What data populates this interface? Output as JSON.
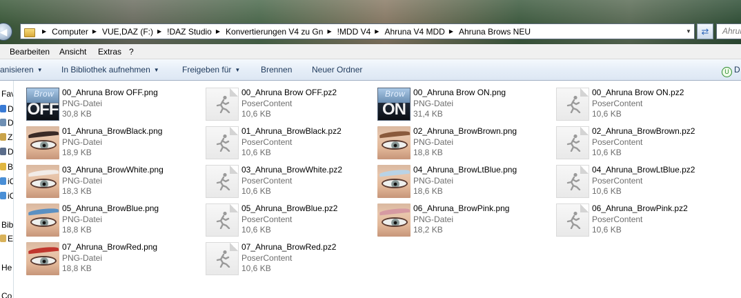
{
  "address_bar": {
    "crumbs": [
      "Computer",
      "VUE,DAZ (F:)",
      "!DAZ Studio",
      "Konvertierungen V4 zu Gn",
      "!MDD V4",
      "Ahruna V4 MDD",
      "Ahruna Brows NEU"
    ],
    "search_placeholder": "Ahrun"
  },
  "menu": [
    "Bearbeiten",
    "Ansicht",
    "Extras",
    "?"
  ],
  "commands": {
    "organize": "anisieren",
    "library": "In Bibliothek aufnehmen",
    "share": "Freigeben für",
    "burn": "Brennen",
    "new_folder": "Neuer Ordner",
    "view_label": "D"
  },
  "nav": {
    "favorites": "Fav",
    "items": [
      "D",
      "D",
      "Z",
      "D",
      "B",
      "iC",
      "iC"
    ],
    "libraries": "Bib",
    "lib_item": "E",
    "homegroup": "He",
    "computer": "Co"
  },
  "files": [
    {
      "name": "00_Ahruna Brow OFF.png",
      "type": "PNG-Datei",
      "size": "30,8 KB",
      "thumb": "off"
    },
    {
      "name": "00_Ahruna Brow OFF.pz2",
      "type": "PoserContent",
      "size": "10,6 KB",
      "thumb": "poser"
    },
    {
      "name": "00_Ahruna Brow ON.png",
      "type": "PNG-Datei",
      "size": "31,4 KB",
      "thumb": "on"
    },
    {
      "name": "00_Ahruna Brow ON.pz2",
      "type": "PoserContent",
      "size": "10,6 KB",
      "thumb": "poser"
    },
    {
      "name": "01_Ahruna_BrowBlack.png",
      "type": "PNG-Datei",
      "size": "18,9 KB",
      "thumb": "eye",
      "brow_color": "#3a2a26"
    },
    {
      "name": "01_Ahruna_BrowBlack.pz2",
      "type": "PoserContent",
      "size": "10,6 KB",
      "thumb": "poser"
    },
    {
      "name": "02_Ahruna_BrowBrown.png",
      "type": "PNG-Datei",
      "size": "18,8 KB",
      "thumb": "eye",
      "brow_color": "#8a5a3c"
    },
    {
      "name": "02_Ahruna_BrowBrown.pz2",
      "type": "PoserContent",
      "size": "10,6 KB",
      "thumb": "poser"
    },
    {
      "name": "03_Ahruna_BrowWhite.png",
      "type": "PNG-Datei",
      "size": "18,3 KB",
      "thumb": "eye",
      "brow_color": "#f2ece8"
    },
    {
      "name": "03_Ahruna_BrowWhite.pz2",
      "type": "PoserContent",
      "size": "10,6 KB",
      "thumb": "poser"
    },
    {
      "name": "04_Ahruna_BrowLtBlue.png",
      "type": "PNG-Datei",
      "size": "18,6 KB",
      "thumb": "eye",
      "brow_color": "#b9d3e6"
    },
    {
      "name": "04_Ahruna_BrowLtBlue.pz2",
      "type": "PoserContent",
      "size": "10,6 KB",
      "thumb": "poser"
    },
    {
      "name": "05_Ahruna_BrowBlue.png",
      "type": "PNG-Datei",
      "size": "18,8 KB",
      "thumb": "eye",
      "brow_color": "#5b90c2"
    },
    {
      "name": "05_Ahruna_BrowBlue.pz2",
      "type": "PoserContent",
      "size": "10,6 KB",
      "thumb": "poser"
    },
    {
      "name": "06_Ahruna_BrowPink.png",
      "type": "PNG-Datei",
      "size": "18,2 KB",
      "thumb": "eye",
      "brow_color": "#d69aa2"
    },
    {
      "name": "06_Ahruna_BrowPink.pz2",
      "type": "PoserContent",
      "size": "10,6 KB",
      "thumb": "poser"
    },
    {
      "name": "07_Ahruna_BrowRed.png",
      "type": "PNG-Datei",
      "size": "18,8 KB",
      "thumb": "eye",
      "brow_color": "#c0362e"
    },
    {
      "name": "07_Ahruna_BrowRed.pz2",
      "type": "PoserContent",
      "size": "10,6 KB",
      "thumb": "poser"
    }
  ],
  "thumb_text": {
    "brow": "Brow",
    "off": "OFF",
    "on": "ON"
  }
}
